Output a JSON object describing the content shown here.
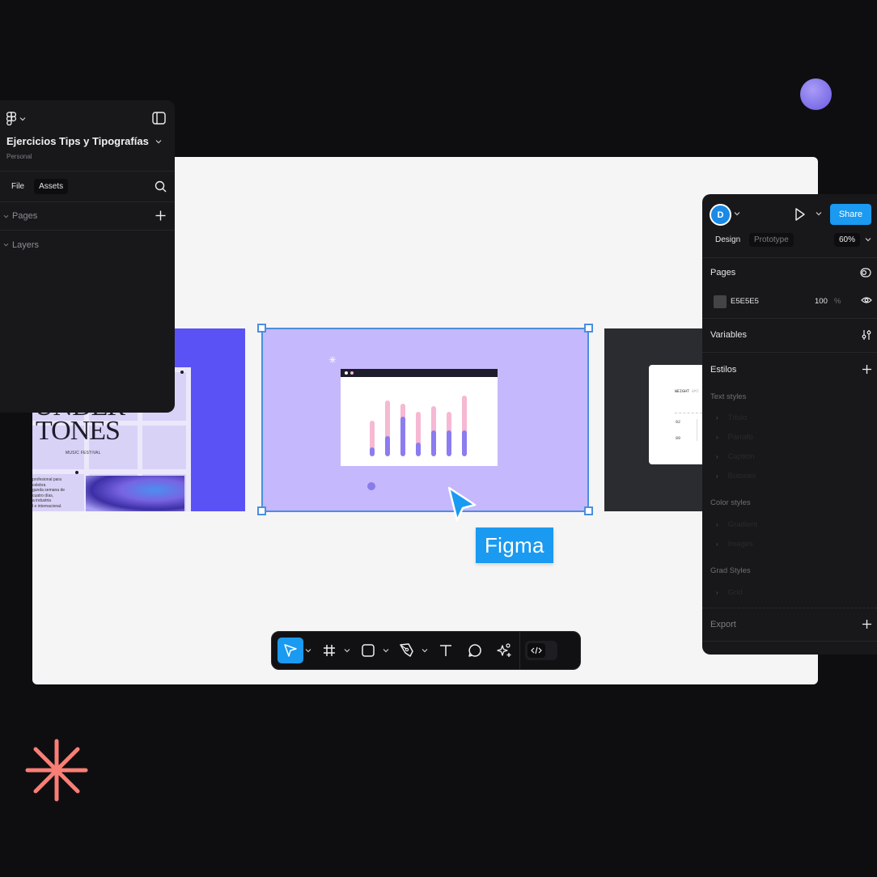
{
  "colors": {
    "accent": "#1a9af0",
    "selection": "#4a8fe0",
    "background": "#0e0e10",
    "panel": "#18181b",
    "canvas": "#f5f5f6",
    "coral": "#f87f76",
    "orb": "#8d7ef0",
    "bar_pink": "#f6b8d2",
    "bar_purple": "#8b7cf0"
  },
  "left_panel": {
    "logo_icon": "figma-logo-icon",
    "file_title": "Ejercicios Tips y Tipografías",
    "team": "Personal",
    "tabs": [
      {
        "label": "File",
        "active": false
      },
      {
        "label": "Assets",
        "active": true
      }
    ],
    "sections": [
      {
        "label": "Pages"
      },
      {
        "label": "Layers"
      }
    ]
  },
  "right_panel": {
    "avatar_initial": "D",
    "share_label": "Share",
    "tabs": [
      {
        "label": "Design",
        "active": true
      },
      {
        "label": "Prototype",
        "active": false
      }
    ],
    "zoom_level": "60%",
    "pages_title": "Pages",
    "page_fill": {
      "hex": "E5E5E5",
      "opacity": "100",
      "unit": "%"
    },
    "variables_title": "Variables",
    "styles_title": "Estilos",
    "text_styles_label": "Text styles",
    "text_styles": [
      "Título",
      "Párrafo",
      "Caption",
      "Botones"
    ],
    "color_styles_label": "Color styles",
    "color_styles": [
      "Gradient",
      "Images"
    ],
    "grid_styles_label": "Grad Styles",
    "grid_styles": [
      "Grid"
    ],
    "export_title": "Export"
  },
  "canvas": {
    "poster": {
      "line1": "UNDER",
      "line2": "TONES",
      "subtitle": "MUSIC FESTIVAL",
      "blurb": [
        "profesional para",
        "celebra",
        "gunda semana de",
        "cuatro días,",
        "a industria",
        "l e internacional."
      ]
    },
    "illustration_bars": [
      {
        "total": 0.58,
        "fill": 0.15
      },
      {
        "total": 0.92,
        "fill": 0.33
      },
      {
        "total": 0.86,
        "fill": 0.65
      },
      {
        "total": 0.73,
        "fill": 0.22
      },
      {
        "total": 0.83,
        "fill": 0.43
      },
      {
        "total": 0.73,
        "fill": 0.43
      },
      {
        "total": 1.0,
        "fill": 0.43
      }
    ],
    "card": {
      "label": "WEIGHT",
      "label_muted": "BMI",
      "values": [
        "92",
        "89"
      ]
    }
  },
  "cursor_label": "Figma",
  "toolbar": {
    "tools": [
      {
        "name": "move",
        "icon": "move-cursor-icon",
        "active": true,
        "dropdown": true
      },
      {
        "name": "frame",
        "icon": "frame-hash-icon",
        "active": false,
        "dropdown": true
      },
      {
        "name": "shape",
        "icon": "rectangle-icon",
        "active": false,
        "dropdown": true
      },
      {
        "name": "pen",
        "icon": "pen-tool-icon",
        "active": false,
        "dropdown": true
      },
      {
        "name": "text",
        "icon": "text-icon",
        "active": false,
        "dropdown": false
      },
      {
        "name": "comment",
        "icon": "comment-icon",
        "active": false,
        "dropdown": false
      },
      {
        "name": "actions",
        "icon": "ai-sparkle-icon",
        "active": false,
        "dropdown": false
      }
    ],
    "dev_mode_icon": "code-icon"
  }
}
